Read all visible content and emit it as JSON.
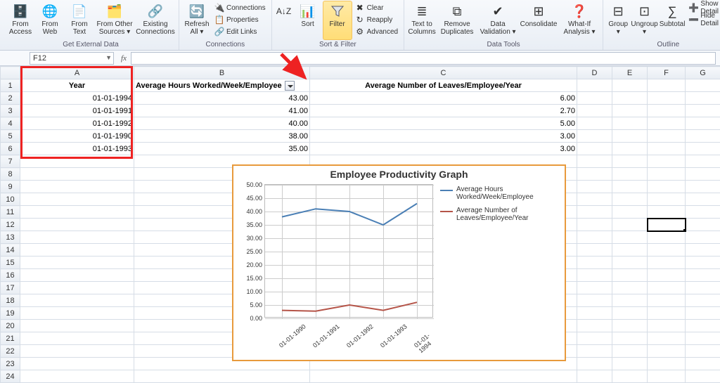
{
  "ribbon": {
    "groups": {
      "external": {
        "label": "Get External Data",
        "fromAccess": "From Access",
        "fromWeb": "From Web",
        "fromText": "From Text",
        "fromOther": "From Other Sources ▾",
        "existing": "Existing Connections"
      },
      "connections": {
        "label": "Connections",
        "refreshAll": "Refresh All ▾",
        "conn": "Connections",
        "props": "Properties",
        "editLinks": "Edit Links"
      },
      "sortFilter": {
        "label": "Sort & Filter",
        "sort": "Sort",
        "filter": "Filter",
        "clear": "Clear",
        "reapply": "Reapply",
        "advanced": "Advanced"
      },
      "dataTools": {
        "label": "Data Tools",
        "textToCol": "Text to Columns",
        "removeDup": "Remove Duplicates",
        "validation": "Data Validation ▾",
        "consolidate": "Consolidate",
        "whatIf": "What-If Analysis ▾"
      },
      "outline": {
        "label": "Outline",
        "group": "Group ▾",
        "ungroup": "Ungroup ▾",
        "subtotal": "Subtotal",
        "showDetail": "Show Detail",
        "hideDetail": "Hide Detail"
      }
    }
  },
  "namebox": "F12",
  "headers": {
    "A": "Year",
    "B": "Average Hours Worked/Week/Employee",
    "C": "Average Number of Leaves/Employee/Year"
  },
  "rows": [
    {
      "year": "01-01-1994",
      "hours": "43.00",
      "leaves": "6.00"
    },
    {
      "year": "01-01-1991",
      "hours": "41.00",
      "leaves": "2.70"
    },
    {
      "year": "01-01-1992",
      "hours": "40.00",
      "leaves": "5.00"
    },
    {
      "year": "01-01-1990",
      "hours": "38.00",
      "leaves": "3.00"
    },
    {
      "year": "01-01-1993",
      "hours": "35.00",
      "leaves": "3.00"
    }
  ],
  "chart_data": {
    "type": "line",
    "title": "Employee Productivity Graph",
    "x": [
      "01-01-1990",
      "01-01-1991",
      "01-01-1992",
      "01-01-1993",
      "01-01-1994"
    ],
    "series": [
      {
        "name": "Average Hours Worked/Week/Employee",
        "values": [
          38.0,
          41.0,
          40.0,
          35.0,
          43.0
        ],
        "color": "#4a7fb5"
      },
      {
        "name": "Average Number of Leaves/Employee/Year",
        "values": [
          3.0,
          2.7,
          5.0,
          3.0,
          6.0
        ],
        "color": "#b55448"
      }
    ],
    "ylim": [
      0,
      50
    ],
    "yticks": [
      "0.00",
      "5.00",
      "10.00",
      "15.00",
      "20.00",
      "25.00",
      "30.00",
      "35.00",
      "40.00",
      "45.00",
      "50.00"
    ]
  }
}
